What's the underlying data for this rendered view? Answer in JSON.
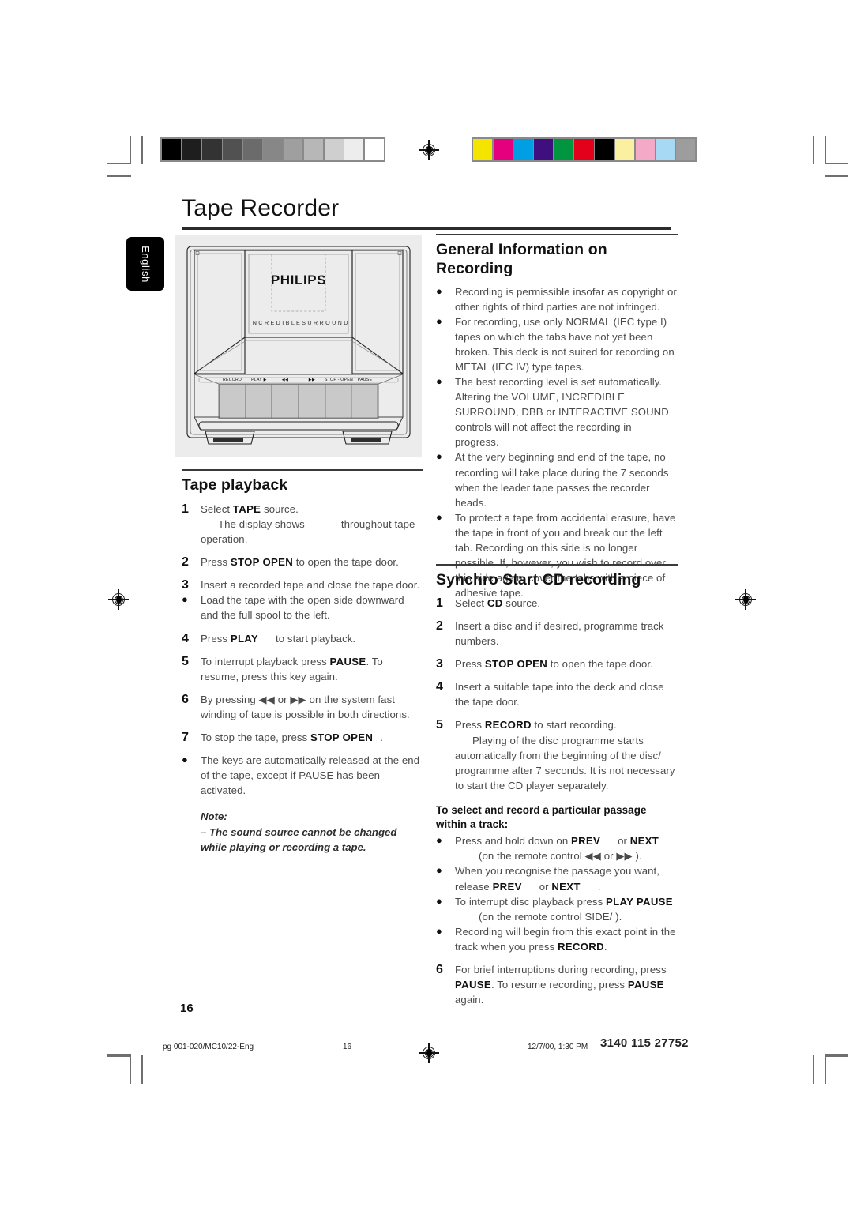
{
  "document": {
    "title": "Tape Recorder",
    "language_tab": "English",
    "page_number": "16"
  },
  "illustration": {
    "brand": "PHILIPS",
    "feature_label": "I N C R E D I  B L E   S U R R O U N D",
    "buttons": [
      "RECORD",
      "PLAY ▶",
      "◀◀",
      "▶▶",
      "STOP - OPEN",
      "PAUSE"
    ]
  },
  "sections": {
    "tape_playback": {
      "heading": "Tape playback",
      "steps": [
        {
          "marker": "1",
          "line1_a": "Select ",
          "key1": "TAPE",
          "line1_b": " source.",
          "line2_a": "The display shows",
          "line2_b": "throughout tape",
          "line3": "operation."
        },
        {
          "marker": "2",
          "a": "Press ",
          "key": "STOP  OPEN",
          "b": " to open the tape door."
        },
        {
          "marker": "3",
          "a": "Insert a recorded tape and close the tape door."
        },
        {
          "marker": "●",
          "a": "Load the tape with the open side downward and the full spool to the left."
        },
        {
          "marker": "4",
          "a": "Press ",
          "key": "PLAY",
          "b": "to start playback."
        },
        {
          "marker": "5",
          "a": "To interrupt playback press ",
          "key": "PAUSE",
          "b": ". To resume, press this key again."
        },
        {
          "marker": "6",
          "a": "By pressing ◀◀ or ▶▶ on the system fast winding of tape is possible in both directions."
        },
        {
          "marker": "7",
          "a": "To stop the tape, press ",
          "key": "STOP  OPEN",
          "b": "."
        },
        {
          "marker": "●",
          "a": "The keys are automatically released at the end of the tape, except if PAUSE has been activated."
        }
      ],
      "note_label": "Note:",
      "note_text": "–  The sound source cannot be changed while playing or recording a tape."
    },
    "general_information": {
      "heading_line1": "General Information on",
      "heading_line2": "Recording",
      "bullets": [
        "Recording is permissible insofar as copyright or other rights of third parties are not infringed.",
        "For recording, use only NORMAL (IEC type I) tapes on which the tabs have not yet been broken. This deck is not suited for recording on METAL (IEC IV) type tapes.",
        "The best recording level is set automatically. Altering the VOLUME, INCREDIBLE SURROUND, DBB or INTERACTIVE SOUND controls will not affect the recording in progress.",
        "At the very beginning and end of the tape, no recording will take place during the 7 seconds when the leader tape passes the recorder heads.",
        "To protect a tape from accidental erasure, have the tape in front of you and break out the left tab. Recording on this side is no longer possible. If, however, you wish to record over this side again, cover the tabs with a piece of adhesive tape."
      ]
    },
    "synchro_start": {
      "heading": "Synchro Start CD recording",
      "steps": [
        {
          "marker": "1",
          "a": "Select ",
          "key": "CD",
          "b": " source."
        },
        {
          "marker": "2",
          "a": "Insert a disc and if desired, programme track numbers."
        },
        {
          "marker": "3",
          "a": "Press ",
          "key": "STOP  OPEN",
          "b": " to open the tape door."
        },
        {
          "marker": "4",
          "a": "Insert a suitable tape into the deck and close the tape door."
        },
        {
          "marker": "5",
          "a": "Press ",
          "key": "RECORD",
          "b": " to start recording.",
          "extra": "Playing of the disc programme starts automatically from the beginning of the disc/ programme  after 7 seconds. It is not necessary to start the CD player separately."
        }
      ],
      "subheading_line1": "To select and record a particular passage",
      "subheading_line2": "within a track:",
      "sub_bullets": [
        {
          "a": "Press and hold down on ",
          "k1": "PREV",
          "mid": "or ",
          "k2": "NEXT",
          "sub": "(on the remote control ◀◀ or ▶▶ )."
        },
        {
          "a": "When you recognise the passage you want, release ",
          "k1": "PREV",
          "mid": "or ",
          "k2": "NEXT",
          "tail": "."
        },
        {
          "a": "To interrupt disc playback press ",
          "k1": "PLAY  PAUSE",
          "sub": "(on the remote control SIDE/  )."
        },
        {
          "a": "Recording will begin from this exact point in the track when you press ",
          "k1": "RECORD",
          "tail": "."
        }
      ],
      "final_step": {
        "marker": "6",
        "a": "For brief interruptions during recording, press ",
        "key1": "PAUSE",
        "b": ". To resume recording, press ",
        "key2": "PAUSE",
        "c": " again."
      }
    }
  },
  "footer": {
    "left": "pg 001-020/MC10/22-Eng",
    "center": "16",
    "date": "12/7/00, 1:30 PM",
    "code": "3140 115 27752"
  },
  "calibration": {
    "grayscale": [
      "#000000",
      "#1e1e1e",
      "#333333",
      "#515151",
      "#6b6b6b",
      "#878787",
      "#9f9f9f",
      "#b7b7b7",
      "#cfcfcf",
      "#ededed",
      "#ffffff"
    ],
    "colors": [
      "#f5e400",
      "#e5007d",
      "#009fe3",
      "#3f0f7f",
      "#009640",
      "#e2001a",
      "#000000",
      "#faf0a0",
      "#f4aac6",
      "#a8d9f4",
      "#9d9d9d"
    ]
  }
}
